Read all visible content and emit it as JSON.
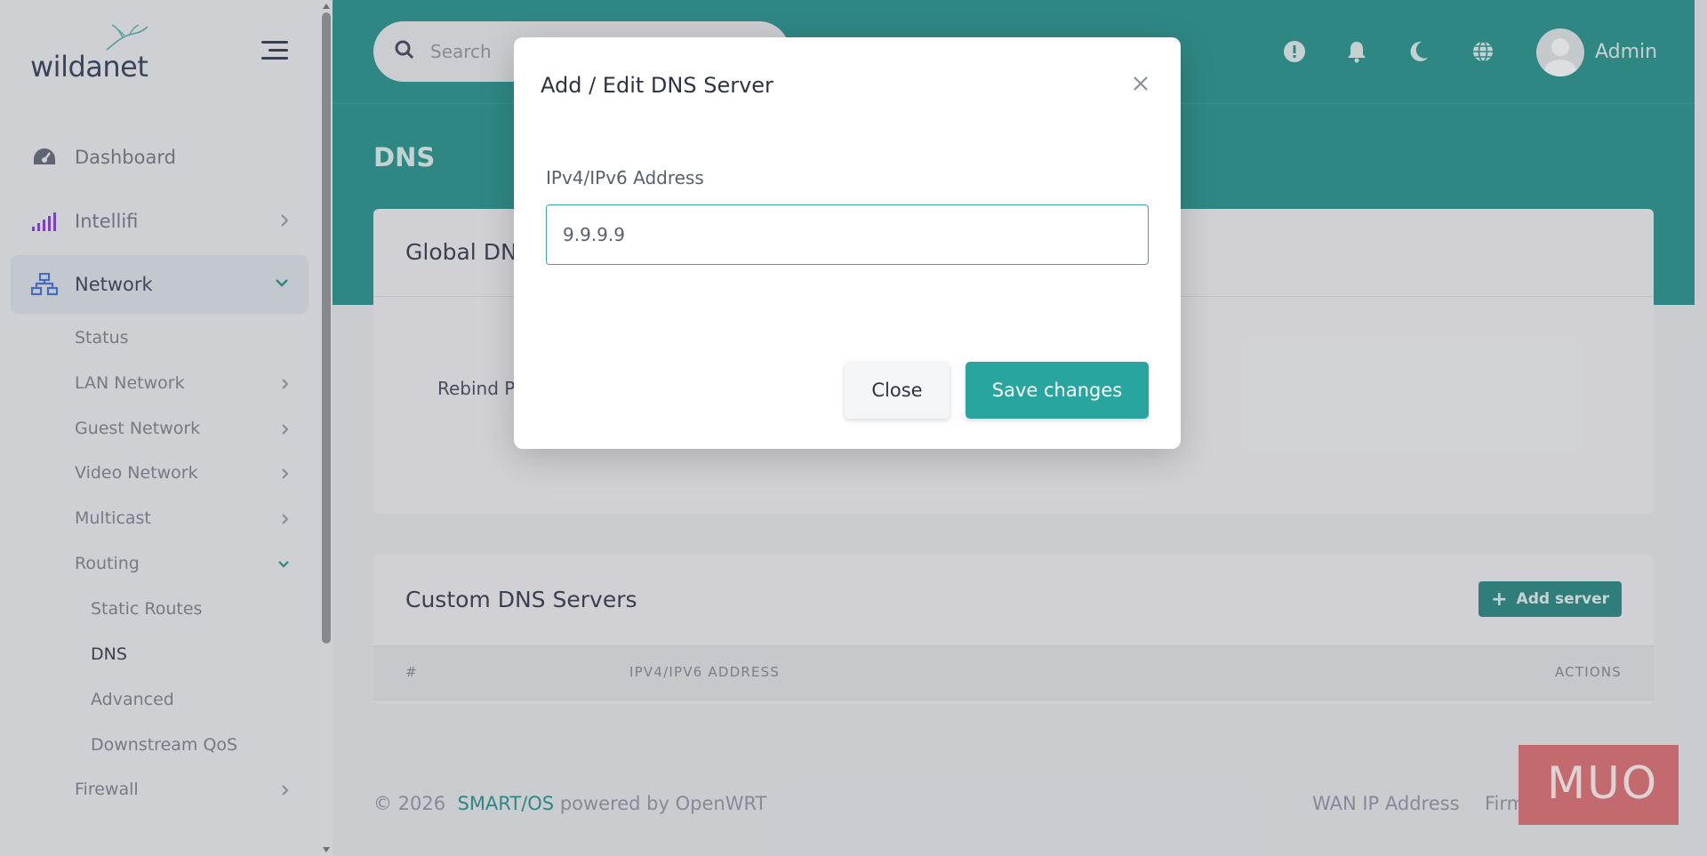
{
  "brand": {
    "logo_text": "wildanet"
  },
  "sidebar": {
    "top_items": [
      {
        "label": "Dashboard",
        "icon": "gauge-icon"
      },
      {
        "label": "Intellifi",
        "icon": "signal-bars-icon"
      },
      {
        "label": "Network",
        "icon": "network-icon"
      }
    ],
    "network_items": [
      {
        "label": "Status"
      },
      {
        "label": "LAN Network"
      },
      {
        "label": "Guest Network"
      },
      {
        "label": "Video Network"
      },
      {
        "label": "Multicast"
      },
      {
        "label": "Routing"
      }
    ],
    "routing_items": [
      {
        "label": "Static Routes"
      },
      {
        "label": "DNS"
      },
      {
        "label": "Advanced"
      },
      {
        "label": "Downstream QoS"
      }
    ],
    "firewall": {
      "label": "Firewall"
    }
  },
  "header": {
    "search_placeholder": "Search",
    "user_name": "Admin",
    "accent_color": "#1f8a86"
  },
  "page": {
    "title": "DNS",
    "global_card": {
      "title": "Global DN",
      "rebind_label": "Rebind P"
    },
    "custom_card": {
      "title": "Custom DNS Servers",
      "add_button": "Add server",
      "columns": [
        "#",
        "IPV4/IPV6 ADDRESS",
        "ACTIONS"
      ]
    }
  },
  "footer": {
    "copyright": "© 2026",
    "brand": "SMART/OS",
    "powered": "powered by OpenWRT",
    "wan_label": "WAN IP Address",
    "firmware_label": "Firmware Version"
  },
  "watermark": {
    "text": "MUO"
  },
  "modal": {
    "title": "Add / Edit DNS Server",
    "field_label": "IPv4/IPv6 Address",
    "field_value": "9.9.9.9",
    "close_label": "Close",
    "save_label": "Save changes",
    "save_color": "#29a59f"
  }
}
